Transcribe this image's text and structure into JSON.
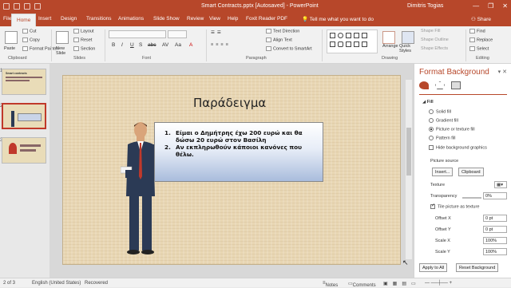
{
  "window": {
    "title": "Smart Contracts.pptx [Autosaved]  -  PowerPoint",
    "user": "Dimitris Togias",
    "controls": [
      "—",
      "❐",
      "✕"
    ]
  },
  "tabs": [
    {
      "label": "File"
    },
    {
      "label": "Home"
    },
    {
      "label": "Insert"
    },
    {
      "label": "Design"
    },
    {
      "label": "Transitions"
    },
    {
      "label": "Animations"
    },
    {
      "label": "Slide Show"
    },
    {
      "label": "Review"
    },
    {
      "label": "View"
    },
    {
      "label": "Help"
    },
    {
      "label": "Foxit Reader PDF"
    }
  ],
  "tellme": "Tell me what you want to do",
  "share": "Share",
  "ribbon": {
    "clipboard": {
      "paste": "Paste",
      "cut": "Cut",
      "copy": "Copy",
      "format_painter": "Format Painter",
      "label": "Clipboard"
    },
    "slides": {
      "new_slide": "New Slide",
      "layout": "Layout",
      "reset": "Reset",
      "section": "Section",
      "label": "Slides"
    },
    "font": {
      "label": "Font",
      "format_buttons": [
        "B",
        "I",
        "U",
        "S",
        "abc",
        "AV",
        "Aa",
        "A"
      ]
    },
    "paragraph": {
      "text_direction": "Text Direction",
      "align_text": "Align Text",
      "convert": "Convert to SmartArt",
      "label": "Paragraph"
    },
    "drawing": {
      "arrange": "Arrange",
      "quick_styles": "Quick Styles",
      "shape_fill": "Shape Fill",
      "shape_outline": "Shape Outline",
      "shape_effects": "Shape Effects",
      "label": "Drawing"
    },
    "editing": {
      "find": "Find",
      "replace": "Replace",
      "select": "Select",
      "label": "Editing"
    }
  },
  "thumbnails": [
    {
      "num": "1",
      "title": "Smart contracts"
    },
    {
      "num": "2",
      "selected": true
    },
    {
      "num": "3"
    }
  ],
  "slide": {
    "title": "Παράδειγμα",
    "items": [
      {
        "num": "1.",
        "text": "Είμαι ο Δημήτρης έχω 200 ευρώ και θα δώσω 20 ευρώ στον Βασίλη"
      },
      {
        "num": "2.",
        "text": "Αν εκπληρωθούν κάποιοι κανόνες που θέλω."
      }
    ]
  },
  "format_pane": {
    "title": "Format Background",
    "fill_header": "Fill",
    "options": [
      {
        "label": "Solid fill",
        "on": false
      },
      {
        "label": "Gradient fill",
        "on": false
      },
      {
        "label": "Picture or texture fill",
        "on": true
      },
      {
        "label": "Pattern fill",
        "on": false
      }
    ],
    "hide_bg": "Hide background graphics",
    "picture_source": "Picture source",
    "insert": "Insert...",
    "clipboard": "Clipboard",
    "texture": "Texture",
    "transparency": "Transparency",
    "transparency_value": "0%",
    "tile": "Tile picture as texture",
    "offset_x_label": "Offset X",
    "offset_x": "0 pt",
    "offset_y_label": "Offset Y",
    "offset_y": "0 pt",
    "scale_x_label": "Scale X",
    "scale_x": "100%",
    "scale_y_label": "Scale Y",
    "scale_y": "100%",
    "apply_all": "Apply to All",
    "reset_bg": "Reset Background"
  },
  "status": {
    "slide": "2 of 3",
    "language": "English (United States)",
    "recovered": "Recovered",
    "notes": "Notes",
    "comments": "Comments"
  },
  "colors": {
    "accent": "#b7472a"
  }
}
